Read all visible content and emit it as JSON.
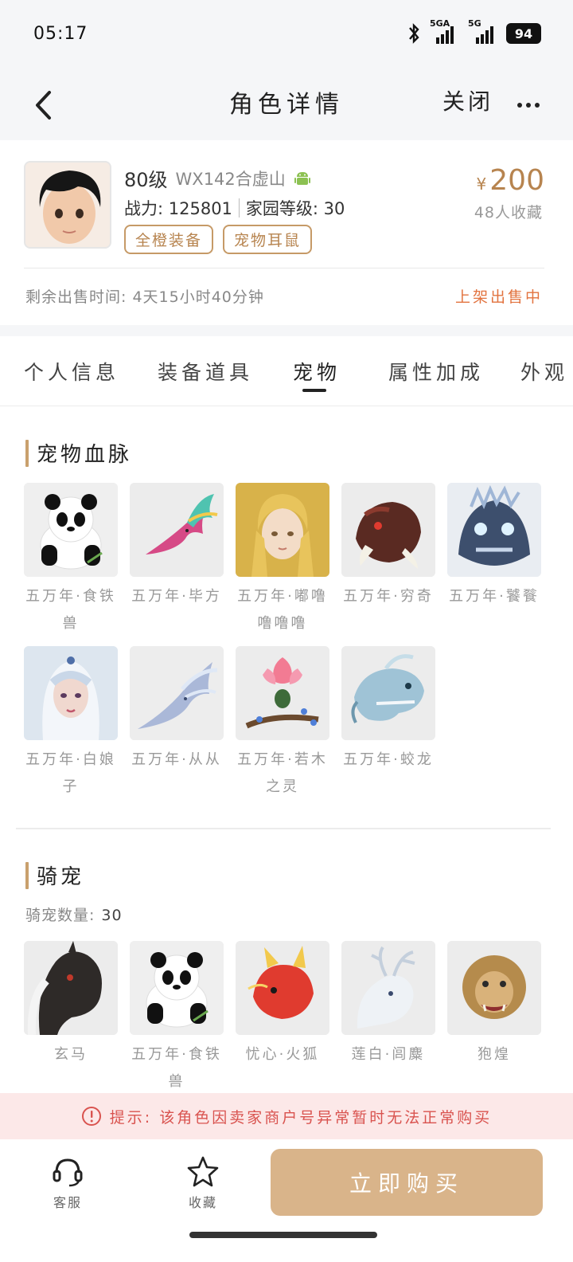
{
  "status_bar": {
    "time": "05:17",
    "network_1": "5GA",
    "network_2": "5G",
    "battery": "94"
  },
  "nav": {
    "title": "角色详情",
    "close_label": "关闭"
  },
  "profile": {
    "level": "80级",
    "server": "WX142合虚山",
    "stats_power": "战力: 125801",
    "stats_home": "家园等级: 30",
    "tags": [
      "全橙装备",
      "宠物耳鼠"
    ],
    "price_currency": "¥",
    "price_value": "200",
    "fav_count": "48人收藏",
    "remain_time": "剩余出售时间: 4天15小时40分钟",
    "sale_status": "上架出售中"
  },
  "tabs": [
    "个人信息",
    "装备道具",
    "宠物",
    "属性加成",
    "外观"
  ],
  "active_tab": "宠物",
  "pet_section": {
    "title": "宠物血脉",
    "pets": [
      {
        "name": "五万年·食铁兽",
        "icon": "panda"
      },
      {
        "name": "五万年·毕方",
        "icon": "bird"
      },
      {
        "name": "五万年·嘟噜噜噜噜",
        "icon": "fairy"
      },
      {
        "name": "五万年·穷奇",
        "icon": "beast"
      },
      {
        "name": "五万年·饕餮",
        "icon": "mask"
      },
      {
        "name": "五万年·白娘子",
        "icon": "lady"
      },
      {
        "name": "五万年·从从",
        "icon": "ice-dragon"
      },
      {
        "name": "五万年·若木之灵",
        "icon": "lotus"
      },
      {
        "name": "五万年·蛟龙",
        "icon": "dragon"
      }
    ]
  },
  "mount_section": {
    "title": "骑宠",
    "count_label": "骑宠数量:",
    "count_value": "30",
    "mounts": [
      {
        "name": "玄马",
        "icon": "horse"
      },
      {
        "name": "五万年·食铁兽",
        "icon": "panda"
      },
      {
        "name": "忧心·火狐",
        "icon": "fox"
      },
      {
        "name": "莲白·闾麋",
        "icon": "deer"
      },
      {
        "name": "狍煌",
        "icon": "lion"
      }
    ]
  },
  "notice": "提示: 该角色因卖家商户号异常暂时无法正常购买",
  "bottom": {
    "service_label": "客服",
    "favorite_label": "收藏",
    "buy_label": "立即购买"
  },
  "colors": {
    "accent": "#c69a67",
    "price": "#b7844f",
    "sale_status": "#e2733f",
    "notice_text": "#d9534f",
    "buy_button": "#d9b48a"
  }
}
